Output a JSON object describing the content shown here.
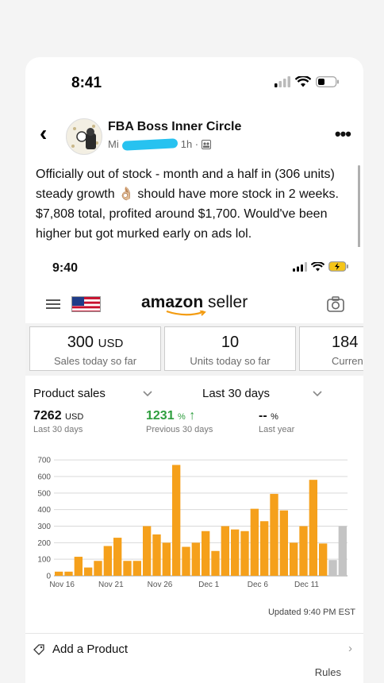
{
  "status_bar": {
    "time": "8:41"
  },
  "post": {
    "group_name": "FBA Boss Inner Circle",
    "author_visible": "Mi",
    "time_ago": "1h ·",
    "text": "Officially out of stock - month and a half in (306 units) steady growth 👌🏼 should have more stock in 2 weeks. $7,808 total, profited around $1,700. Would've been higher but got murked early on ads lol."
  },
  "screenshot": {
    "status_time": "9:40",
    "brand_main": "amazon",
    "brand_sub": " seller",
    "kpis": [
      {
        "value": "300",
        "unit": "USD",
        "label": "Sales today so far"
      },
      {
        "value": "10",
        "unit": "",
        "label": "Units today so far"
      },
      {
        "value": "184",
        "unit": "",
        "label": "Current"
      }
    ],
    "product_sales_label": "Product sales",
    "range_label": "Last 30 days",
    "stats": [
      {
        "value": "7262",
        "unit": "USD",
        "label": "Last 30 days",
        "color": "#111111"
      },
      {
        "value": "1231",
        "unit": "%",
        "arrow": "↑",
        "label": "Previous 30 days",
        "color": "#2e9e3e"
      },
      {
        "value": "--",
        "unit": "%",
        "arrow": "",
        "label": "Last year",
        "color": "#111111"
      }
    ],
    "updated": "Updated 9:40 PM EST",
    "add_product": "Add a Product",
    "rules": "Rules"
  },
  "chart_data": {
    "type": "bar",
    "y_ticks": [
      0,
      100,
      200,
      300,
      400,
      500,
      600,
      700
    ],
    "ylim": [
      0,
      720
    ],
    "x_tick_labels": [
      {
        "index": 0,
        "label": "Nov 16"
      },
      {
        "index": 5,
        "label": "Nov 21"
      },
      {
        "index": 10,
        "label": "Nov 26"
      },
      {
        "index": 15,
        "label": "Dec 1"
      },
      {
        "index": 20,
        "label": "Dec 6"
      },
      {
        "index": 25,
        "label": "Dec 11"
      }
    ],
    "values": [
      25,
      25,
      115,
      50,
      90,
      180,
      230,
      90,
      90,
      300,
      250,
      200,
      670,
      175,
      200,
      270,
      150,
      300,
      280,
      270,
      405,
      330,
      495,
      395,
      200,
      300,
      580,
      195,
      95,
      300
    ],
    "bar_color": "#f5a01b",
    "muted_color": "#c4c4c4",
    "muted_indices": [
      28,
      29
    ],
    "grid": true
  }
}
